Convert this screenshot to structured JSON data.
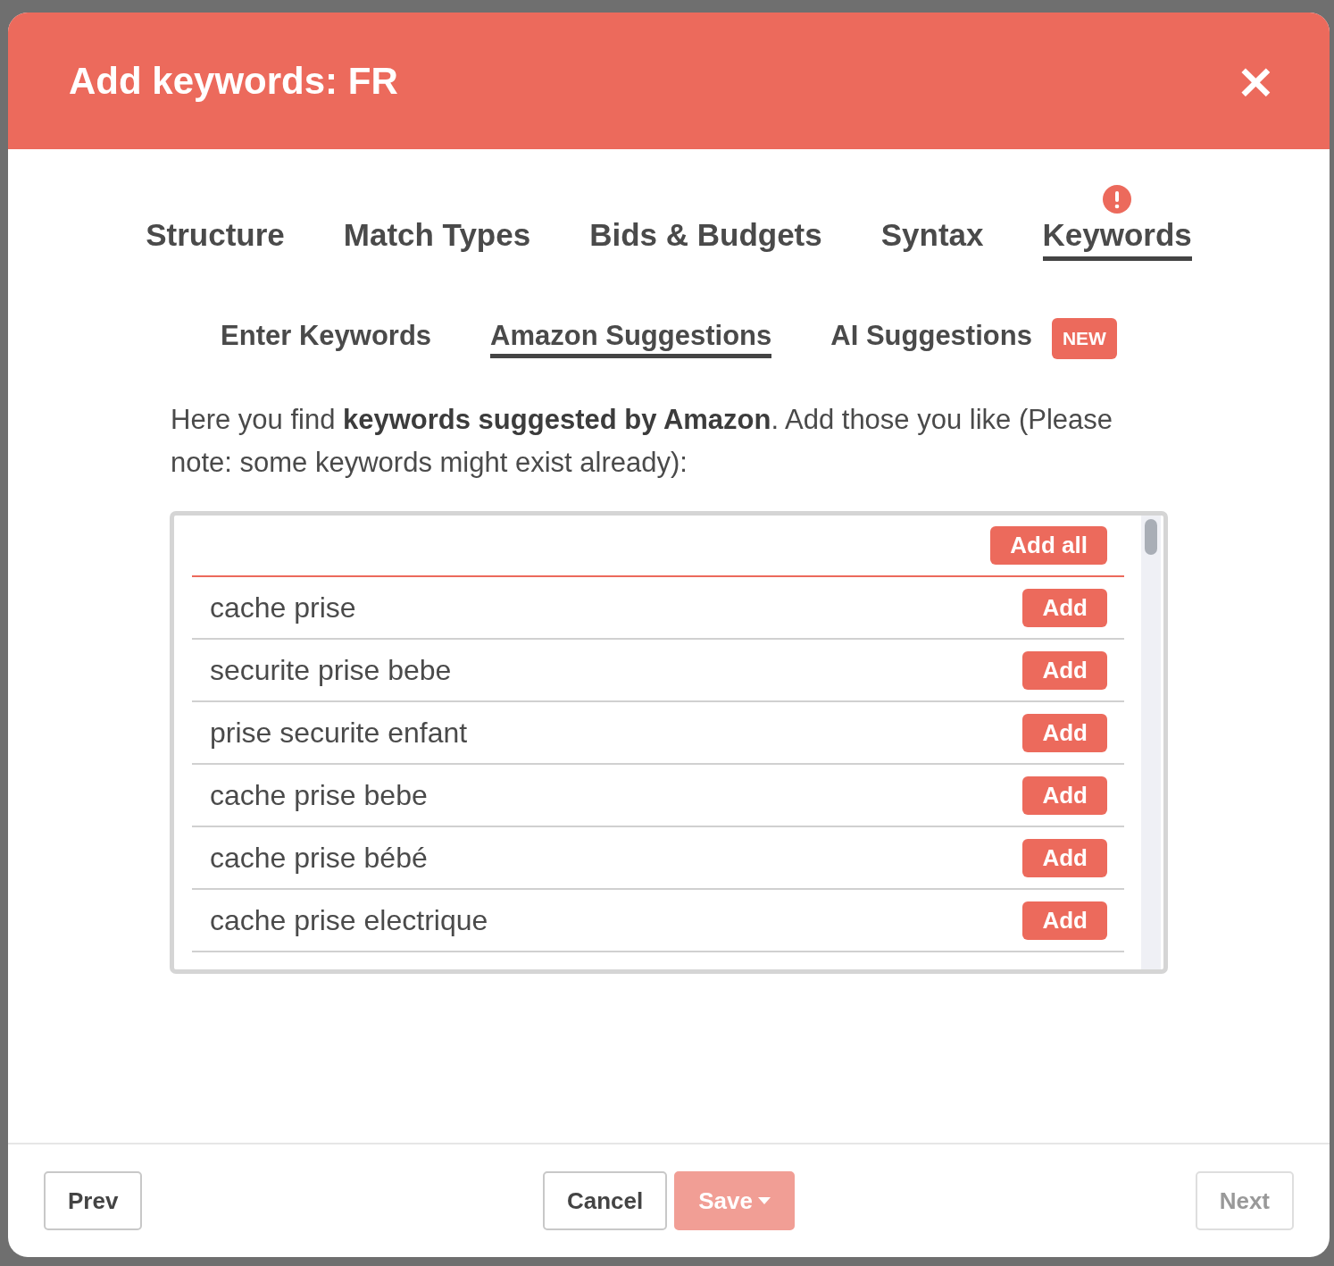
{
  "dialog": {
    "title": "Add keywords: FR",
    "close": "×"
  },
  "steps": [
    {
      "label": "Structure",
      "selected": false,
      "alert": false
    },
    {
      "label": "Match Types",
      "selected": false,
      "alert": false
    },
    {
      "label": "Bids & Budgets",
      "selected": false,
      "alert": false
    },
    {
      "label": "Syntax",
      "selected": false,
      "alert": false
    },
    {
      "label": "Keywords",
      "selected": true,
      "alert": true
    }
  ],
  "subtabs": [
    {
      "label": "Enter Keywords",
      "selected": false
    },
    {
      "label": "Amazon Suggestions",
      "selected": true
    },
    {
      "label": "AI Suggestions",
      "selected": false,
      "badge": "NEW"
    }
  ],
  "intro": "Here you find **keywords suggested by Amazon**. Add those you like (Please note: some keywords might exist already):",
  "suggestions": {
    "add_all": "Add all",
    "rows": [
      {
        "keyword": "cache prise",
        "action": "Add"
      },
      {
        "keyword": "securite prise bebe",
        "action": "Add"
      },
      {
        "keyword": "prise securite enfant",
        "action": "Add"
      },
      {
        "keyword": "cache prise bebe",
        "action": "Add"
      },
      {
        "keyword": "cache prise bébé",
        "action": "Add"
      },
      {
        "keyword": "cache prise electrique",
        "action": "Add"
      }
    ]
  },
  "footer": {
    "left": [
      {
        "label": "Prev",
        "kind": "plain",
        "disabled": false
      }
    ],
    "center": [
      {
        "label": "Cancel",
        "kind": "plain",
        "disabled": false
      },
      {
        "label": "Save",
        "kind": "primary",
        "disabled": true,
        "dropdown": true
      }
    ],
    "right": [
      {
        "label": "Next",
        "kind": "plain",
        "disabled": true
      }
    ]
  }
}
